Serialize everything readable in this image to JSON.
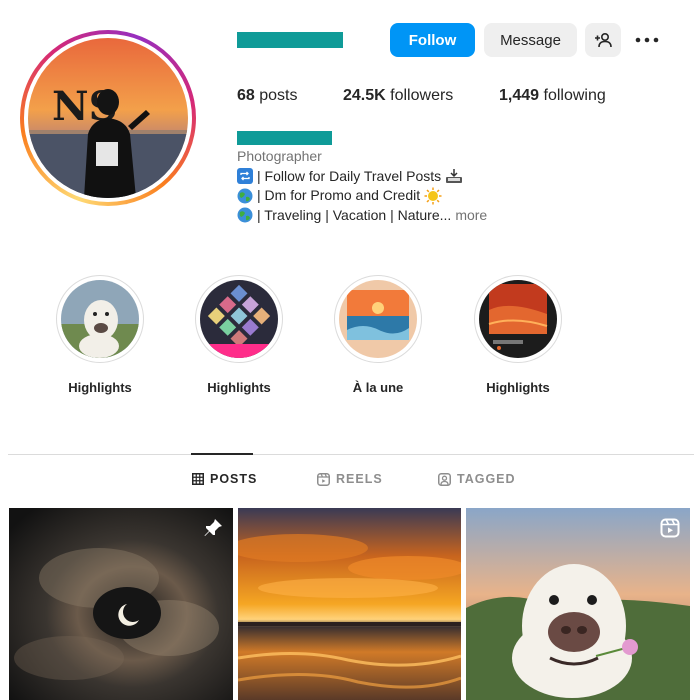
{
  "header": {
    "follow_label": "Follow",
    "message_label": "Message",
    "suggest_icon": "person-add-icon",
    "more_icon": "more-options-icon"
  },
  "stats": {
    "posts_count": "68",
    "posts_label": "posts",
    "followers_count": "24.5K",
    "followers_label": "followers",
    "following_count": "1,449",
    "following_label": "following"
  },
  "bio": {
    "category": "Photographer",
    "line1": "| Follow for Daily Travel Posts",
    "line2": "| Dm for Promo and Credit",
    "line3": "| Traveling | Vacation | Nature...",
    "more_label": "more"
  },
  "avatar": {
    "initials": "NS"
  },
  "highlights": [
    {
      "label": "Highlights"
    },
    {
      "label": "Highlights"
    },
    {
      "label": "À la une"
    },
    {
      "label": "Highlights"
    }
  ],
  "tabs": {
    "posts": "POSTS",
    "reels": "REELS",
    "tagged": "TAGGED"
  },
  "colors": {
    "accent": "#0095f6",
    "redaction": "#0f9b98",
    "button_gray": "#efefef"
  }
}
